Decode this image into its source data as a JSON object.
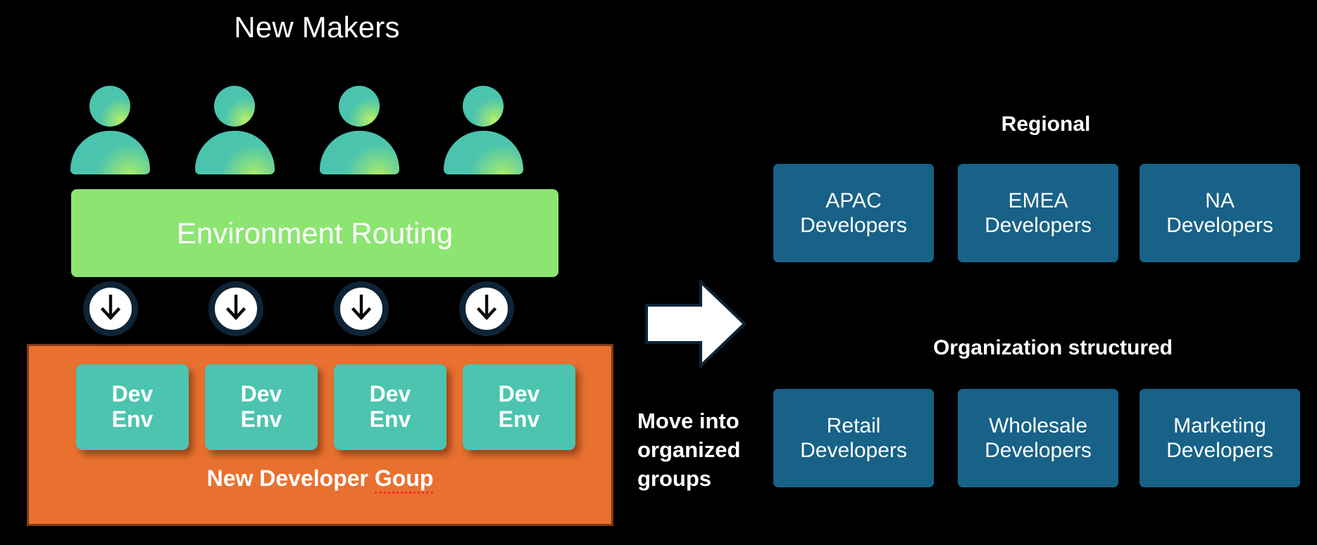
{
  "left_panel": {
    "title": "New Makers",
    "people_count": 4,
    "person_icon": "person-icon",
    "routing_band": {
      "label": "Environment Routing",
      "color": "#8ce571"
    },
    "flow_arrows": {
      "icon": "arrow-down-icon",
      "count": 4
    },
    "developer_group": {
      "label_prefix": "New Developer ",
      "label_misspelled": "Goup",
      "full_label": "New Developer Goup",
      "color": "#e9712f",
      "dev_envs": [
        {
          "line1": "Dev",
          "line2": "Env"
        },
        {
          "line1": "Dev",
          "line2": "Env"
        },
        {
          "line1": "Dev",
          "line2": "Env"
        },
        {
          "line1": "Dev",
          "line2": "Env"
        }
      ],
      "env_color": "#4cc4b0"
    }
  },
  "transition": {
    "arrow_icon": "arrow-right-icon",
    "caption": "Move into organized groups"
  },
  "right_panel": {
    "regional": {
      "heading": "Regional",
      "cards": [
        {
          "line1": "APAC",
          "line2": "Developers"
        },
        {
          "line1": "EMEA",
          "line2": "Developers"
        },
        {
          "line1": "NA",
          "line2": "Developers"
        }
      ]
    },
    "organization": {
      "heading": "Organization structured",
      "cards": [
        {
          "line1": "Retail",
          "line2": "Developers"
        },
        {
          "line1": "Wholesale",
          "line2": "Developers"
        },
        {
          "line1": "Marketing",
          "line2": "Developers"
        }
      ]
    },
    "card_color": "#186187"
  }
}
